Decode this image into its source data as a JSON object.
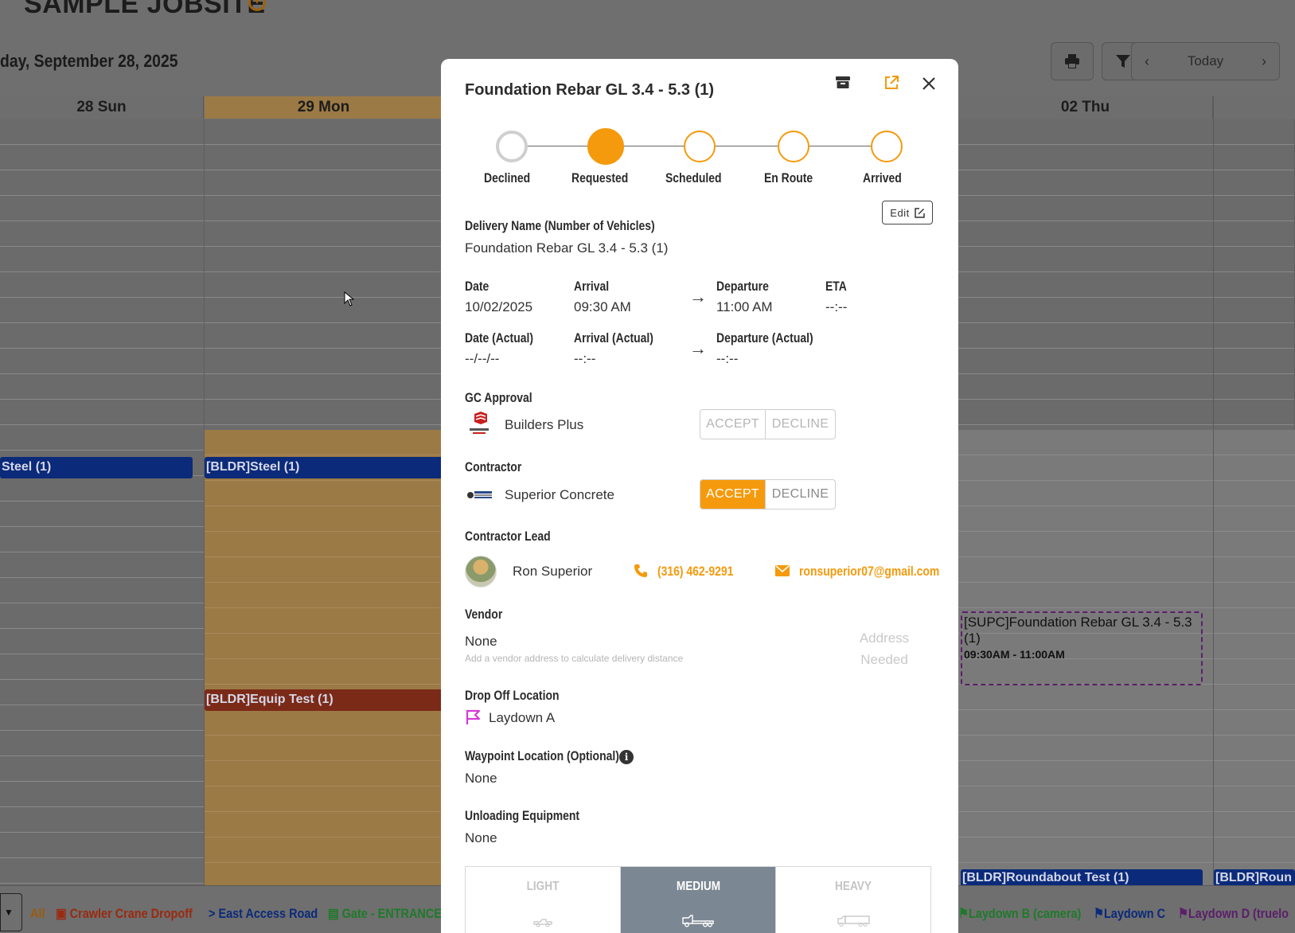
{
  "jobsite": {
    "title": "SAMPLE JOBSITE"
  },
  "calendar": {
    "date_heading": "day, September 28, 2025",
    "today_label": "Today",
    "columns": [
      "28 Sun",
      "29 Mon",
      "02 Thu"
    ],
    "events": {
      "steel_sun": "Steel (1)",
      "steel_mon": "[BLDR]Steel (1)",
      "equip_test": "[BLDR]Equip Test (1)",
      "foundation_title": "[SUPC]Foundation Rebar GL 3.4 - 5.3 (1)",
      "foundation_time": "09:30AM - 11:00AM",
      "roundabout": "[BLDR]Roundabout Test (1)",
      "roundabout2": "[BLDR]Roun"
    }
  },
  "legend": {
    "all": "All",
    "items": [
      "Crawler Crane Dropoff",
      "> East Access Road",
      "Gate - ENTRANCE",
      "Laydown B (camera)",
      "Laydown C",
      "Laydown D (truelo"
    ],
    "colors": [
      "#9a2a10",
      "#0b2a7a",
      "#1e7a2a",
      "#1e7a2a",
      "#0b2a7a",
      "#5a1f6a"
    ]
  },
  "modal": {
    "title": "Foundation Rebar GL 3.4 - 5.3 (1)",
    "steps": [
      "Declined",
      "Requested",
      "Scheduled",
      "En Route",
      "Arrived"
    ],
    "edit_label": "Edit",
    "delivery_name_label": "Delivery Name (Number of Vehicles)",
    "delivery_name": "Foundation Rebar GL 3.4 - 5.3 (1)",
    "date_label": "Date",
    "date": "10/02/2025",
    "arrival_label": "Arrival",
    "arrival": "09:30 AM",
    "departure_label": "Departure",
    "departure": "11:00 AM",
    "eta_label": "ETA",
    "eta": "--:--",
    "date_actual_label": "Date (Actual)",
    "date_actual": "--/--/--",
    "arrival_actual_label": "Arrival (Actual)",
    "arrival_actual": "--:--",
    "departure_actual_label": "Departure (Actual)",
    "departure_actual": "--:--",
    "gc_approval_label": "GC Approval",
    "gc_company": "Builders Plus",
    "contractor_label": "Contractor",
    "contractor_company": "Superior Concrete",
    "accept_label": "ACCEPT",
    "decline_label": "DECLINE",
    "contractor_lead_label": "Contractor Lead",
    "lead_name": "Ron Superior",
    "lead_phone": "(316) 462-9291",
    "lead_email": "ronsuperior07@gmail.com",
    "vendor_label": "Vendor",
    "vendor": "None",
    "vendor_hint": "Add a vendor address to calculate delivery distance",
    "address_needed": "Address Needed",
    "dropoff_label": "Drop Off Location",
    "dropoff": "Laydown A",
    "waypoint_label": "Waypoint Location (Optional)",
    "waypoint": "None",
    "unloading_label": "Unloading Equipment",
    "unloading": "None",
    "equipment_options": [
      "LIGHT",
      "MEDIUM",
      "HEAVY"
    ],
    "selected_equipment": "MEDIUM"
  },
  "colors": {
    "accent": "#f59a0c",
    "selected_equipment": "#7c8794"
  }
}
